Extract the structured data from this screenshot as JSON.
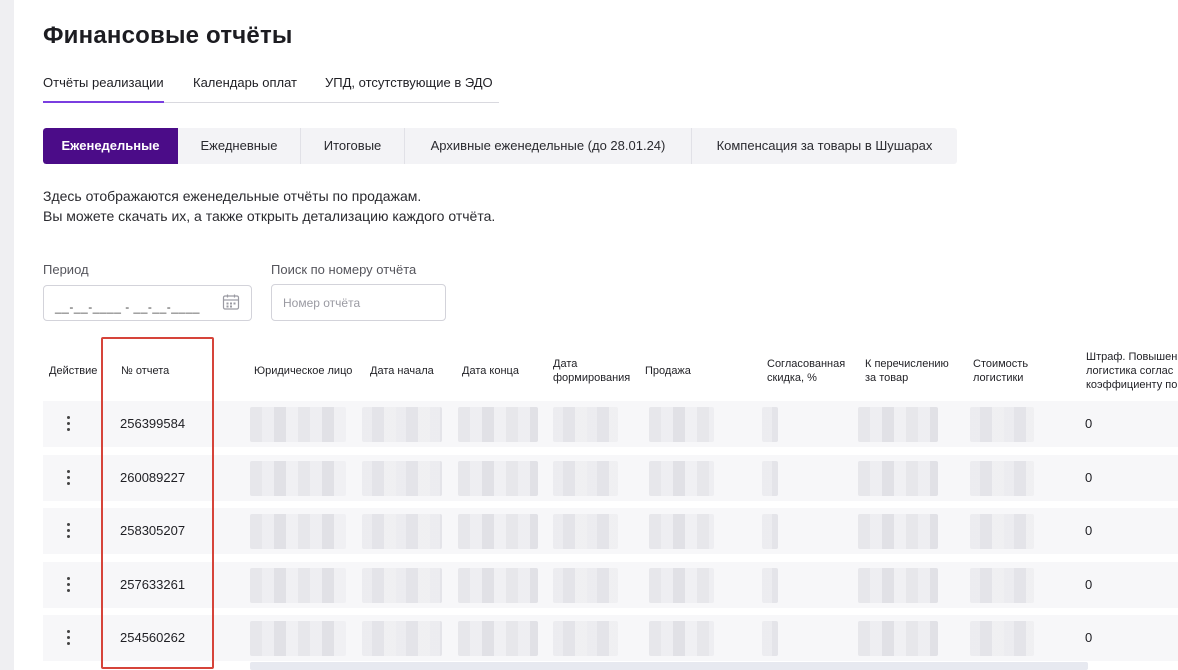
{
  "page_title": "Финансовые отчёты",
  "tabs": [
    {
      "label": "Отчёты реализации",
      "active": true
    },
    {
      "label": "Календарь оплат",
      "active": false
    },
    {
      "label": "УПД, отсутствующие в ЭДО",
      "active": false
    }
  ],
  "report_types": [
    {
      "label": "Еженедельные",
      "active": true
    },
    {
      "label": "Ежедневные",
      "active": false
    },
    {
      "label": "Итоговые",
      "active": false
    },
    {
      "label": "Архивные еженедельные (до 28.01.24)",
      "active": false
    },
    {
      "label": "Компенсация за товары в Шушарах",
      "active": false
    }
  ],
  "intro": {
    "line1": "Здесь отображаются еженедельные отчёты по продажам.",
    "line2": "Вы можете скачать их, а также открыть детализацию каждого отчёта."
  },
  "filters": {
    "period_label": "Период",
    "period_value": "__-__-____ - __-__-____",
    "search_label": "Поиск по номеру отчёта",
    "search_placeholder": "Номер отчёта"
  },
  "table": {
    "columns": {
      "action": "Действие",
      "report_number": "№ отчета",
      "legal_entity": "Юридическое лицо",
      "start_date": "Дата начала",
      "end_date": "Дата конца",
      "formation_date_1": "Дата",
      "formation_date_2": "формирования",
      "sale": "Продажа",
      "discount_1": "Согласованная",
      "discount_2": "скидка, %",
      "transfer_1": "К перечислению",
      "transfer_2": "за товар",
      "logistics_1": "Стоимость",
      "logistics_2": "логистики",
      "penalty_1": "Штраф. Повышен",
      "penalty_2": "логистика соглас",
      "penalty_3": "коэффициенту по"
    },
    "rows": [
      {
        "number": "256399584",
        "penalty": "0"
      },
      {
        "number": "260089227",
        "penalty": "0"
      },
      {
        "number": "258305207",
        "penalty": "0"
      },
      {
        "number": "257633261",
        "penalty": "0"
      },
      {
        "number": "254560262",
        "penalty": "0"
      }
    ]
  },
  "colors": {
    "accent": "#4b0c88",
    "tab_underline": "#7a3ee0",
    "highlight_border": "#d6443a"
  }
}
